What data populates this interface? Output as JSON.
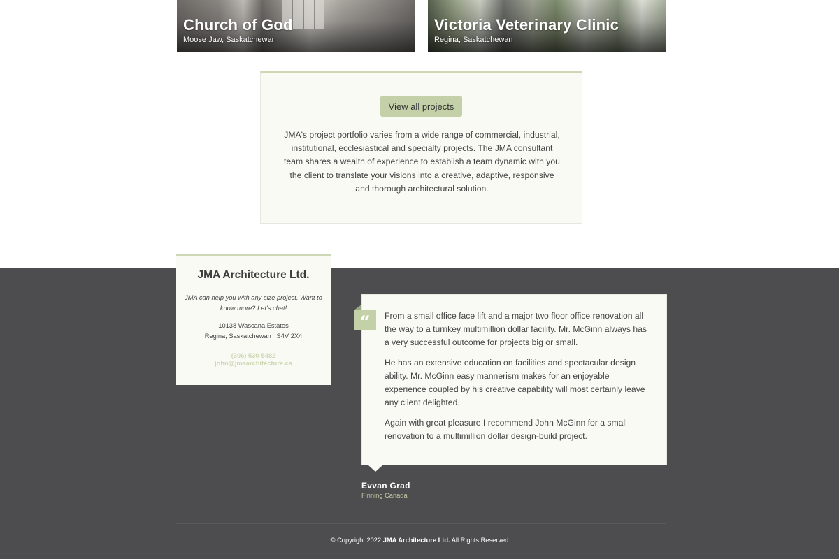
{
  "projects": [
    {
      "title": "Church of God",
      "location": "Moose Jaw, Saskatchewan"
    },
    {
      "title": "Victoria Veterinary Clinic",
      "location": "Regina, Saskatchewan"
    }
  ],
  "portfolio": {
    "button_label": "View all projects",
    "description": "JMA's project portfolio varies from a wide range of commercial, industrial, institutional, ecclesiastical and specialty projects. The JMA consultant team shares a wealth of experience to establish a team dynamic with you the client to translate your visions into a creative, adaptive, responsive and thorough architectural solution."
  },
  "contact": {
    "company": "JMA Architecture Ltd.",
    "tagline": "JMA can help you with any size project. Want to know more? Let's chat!",
    "address_line1": "10138 Wascana Estates",
    "address_line2": "Regina, Saskatchewan   S4V 2X4",
    "phone": "(306) 530-5482",
    "email": "john@jmaarchitecture.ca"
  },
  "testimonial": {
    "quote_icon": "quote-icon",
    "paragraphs": [
      "From a small office face lift and a major two floor office renovation all the way to a turnkey multimillion dollar facility. Mr. McGinn always has a very successful outcome for projects big or small.",
      "He has an extensive education on facilities and spectacular design ability. Mr. McGinn easy mannerism makes for an enjoyable experience coupled by his creative capability will most certainly leave any client delighted.",
      "Again with great pleasure I recommend John McGinn for a small renovation to a multimillion dollar design-build project."
    ],
    "author": "Evvan Grad",
    "organization": "Finning Canada"
  },
  "footer": {
    "copyright_prefix": "© Copyright 2022",
    "copyright_company": "JMA Architecture Ltd.",
    "copyright_suffix": "All Rights Reserved"
  },
  "colors": {
    "accent": "#c4d0a7",
    "footer_bg": "#4d4d4f",
    "card_bg": "#f9faf4"
  }
}
